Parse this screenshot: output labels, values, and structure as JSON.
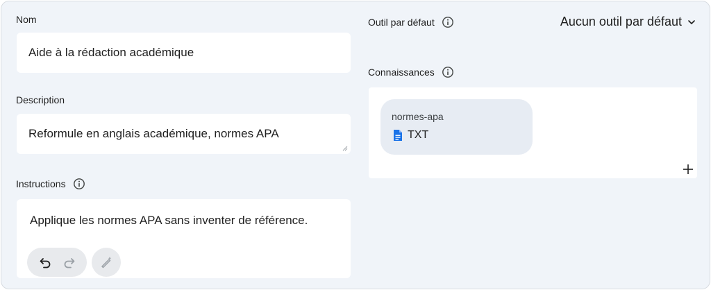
{
  "form": {
    "name": {
      "label": "Nom",
      "value": "Aide à la rédaction académique"
    },
    "description": {
      "label": "Description",
      "value": "Reformule en anglais académique, normes APA"
    },
    "instructions": {
      "label": "Instructions",
      "value": "Applique les normes APA sans inventer de référence."
    }
  },
  "default_tool": {
    "label": "Outil par défaut",
    "selected": "Aucun outil par défaut"
  },
  "knowledge": {
    "label": "Connaissances",
    "files": [
      {
        "name": "normes-apa",
        "type": "TXT"
      }
    ]
  },
  "colors": {
    "accent": "#1a73e8",
    "background": "#f0f4f9",
    "chip": "#e7ecf3",
    "icon_gray": "#5f6368"
  },
  "icons": [
    "info-icon",
    "undo-icon",
    "redo-icon",
    "magic-wand-icon",
    "chevron-down-icon",
    "document-icon",
    "plus-icon"
  ]
}
